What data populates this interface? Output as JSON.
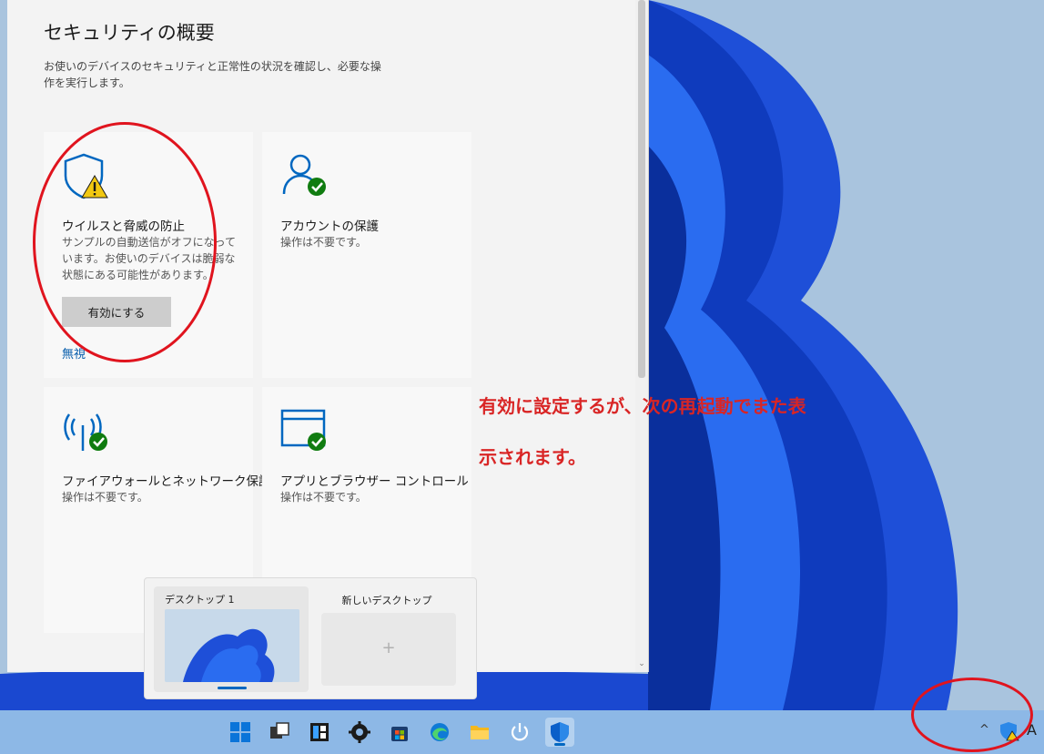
{
  "window": {
    "title": "セキュリティの概要",
    "description": "お使いのデバイスのセキュリティと正常性の状況を確認し、必要な操作を実行します。"
  },
  "tiles": [
    {
      "name": "ウイルスと脅威の防止",
      "status": "サンプルの自動送信がオフになっています。お使いのデバイスは脆弱な状態にある可能性があります。",
      "button": "有効にする",
      "link": "無視",
      "icon": "shield-warning-icon"
    },
    {
      "name": "アカウントの保護",
      "status": "操作は不要です。",
      "icon": "account-check-icon"
    },
    {
      "name": "ファイアウォールとネットワーク保護",
      "status": "操作は不要です。",
      "icon": "network-check-icon"
    },
    {
      "name": "アプリとブラウザー コントロール",
      "status": "操作は不要です。",
      "icon": "app-browser-check-icon"
    }
  ],
  "annotation": {
    "line1": "有効に設定するが、次の再起動でまた表",
    "line2": "示されます。"
  },
  "task_view": {
    "desktop1": "デスクトップ 1",
    "new_desktop": "新しいデスクトップ",
    "plus": "+"
  },
  "taskbar": {
    "icons": [
      "start-icon",
      "task-view-icon",
      "widgets-icon",
      "settings-icon",
      "store-icon",
      "edge-icon",
      "file-explorer-icon",
      "power-icon",
      "defender-icon"
    ],
    "tray_chevron": "^",
    "ime": "A"
  },
  "colors": {
    "accent": "#0067c0",
    "annotation_red": "#d92525",
    "ok_green": "#107c10",
    "warning_yellow": "#f2c811"
  }
}
